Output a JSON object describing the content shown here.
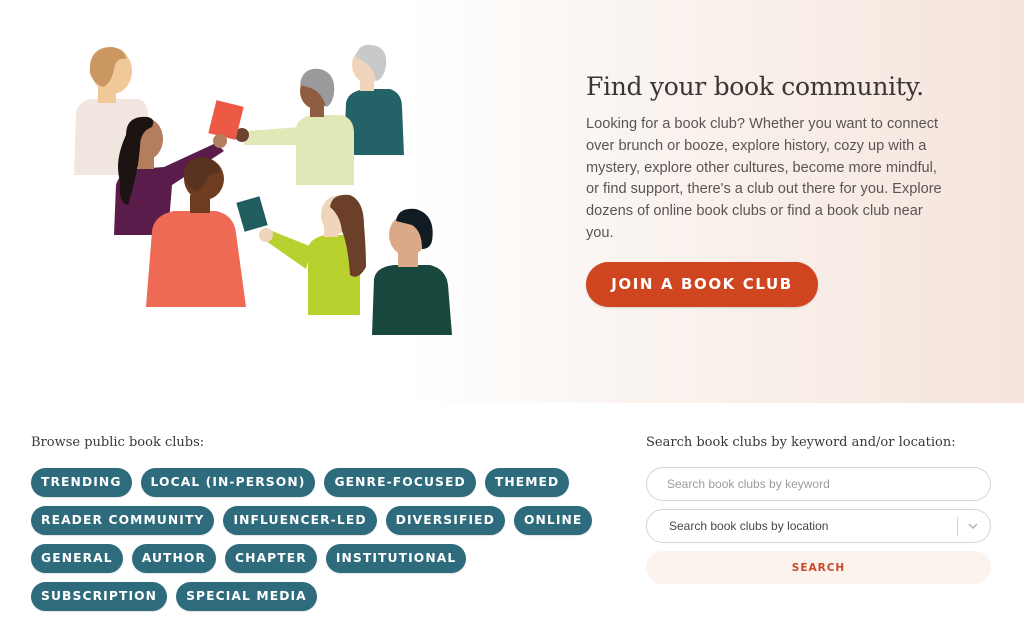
{
  "hero": {
    "title": "Find your book community.",
    "description": "Looking for a book club? Whether you want to connect over brunch or booze, explore history, cozy up with a mystery, explore other cultures, become more mindful, or find support, there's a club out there for you. Explore dozens of online book clubs or find a book club near you.",
    "cta_label": "JOIN A BOOK CLUB",
    "illustration": "people-sharing-books-illustration"
  },
  "browse": {
    "label": "Browse public book clubs:",
    "categories": [
      {
        "label": "TRENDING"
      },
      {
        "label": "LOCAL (IN-PERSON)"
      },
      {
        "label": "GENRE-FOCUSED"
      },
      {
        "label": "THEMED"
      },
      {
        "label": "READER COMMUNITY"
      },
      {
        "label": "INFLUENCER-LED"
      },
      {
        "label": "DIVERSIFIED"
      },
      {
        "label": "ONLINE"
      },
      {
        "label": "GENERAL"
      },
      {
        "label": "AUTHOR"
      },
      {
        "label": "CHAPTER"
      },
      {
        "label": "INSTITUTIONAL"
      },
      {
        "label": "SUBSCRIPTION"
      },
      {
        "label": "SPECIAL MEDIA"
      }
    ]
  },
  "search": {
    "label": "Search book clubs by keyword and/or location:",
    "keyword_placeholder": "Search book clubs by keyword",
    "keyword_value": "",
    "location_placeholder": "Search book clubs by location",
    "button_label": "SEARCH"
  },
  "colors": {
    "cta": "#cf4520",
    "chip": "#2e6b7c",
    "search_button_bg": "#fcf3ee",
    "search_button_text": "#c9492a",
    "hero_gradient_end": "#f5e4dc"
  }
}
